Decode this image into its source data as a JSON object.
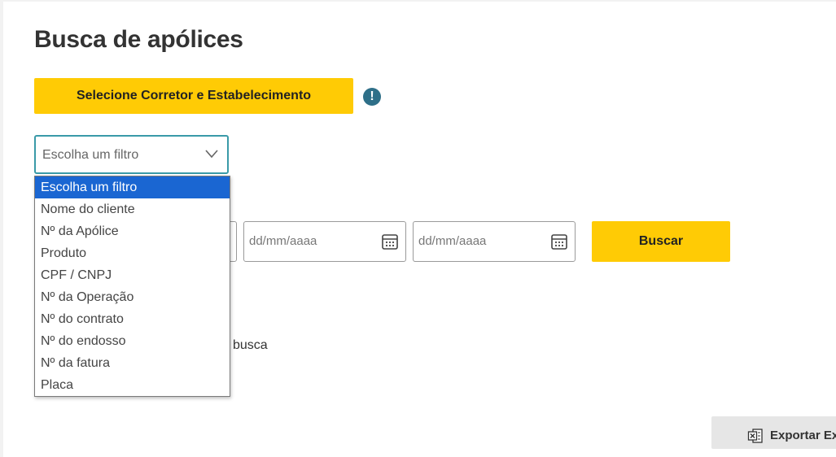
{
  "page": {
    "title": "Busca de apólices"
  },
  "broker": {
    "button_label": "Selecione Corretor e Estabelecimento",
    "alert_icon": "exclamation-circle-icon",
    "alert_symbol": "!"
  },
  "filter": {
    "selected_value": "Escolha um filtro",
    "options": [
      "Escolha um filtro",
      "Nome do cliente",
      "Nº da Apólice",
      "Produto",
      "CPF / CNPJ",
      "Nº da Operação",
      "Nº do contrato",
      "Nº do endosso",
      "Nº da fatura",
      "Placa"
    ],
    "highlighted_index": 0
  },
  "dates": {
    "start_placeholder": "dd/mm/aaaa",
    "end_placeholder": "dd/mm/aaaa"
  },
  "search": {
    "button_label": "Buscar"
  },
  "hint_text": "busca",
  "export": {
    "button_label": "Exportar Ex"
  },
  "colors": {
    "accent": "#ffcb05",
    "focus_border": "#3a9aa8",
    "selected_option": "#1a66d2",
    "alert_icon": "#2e6f88"
  }
}
